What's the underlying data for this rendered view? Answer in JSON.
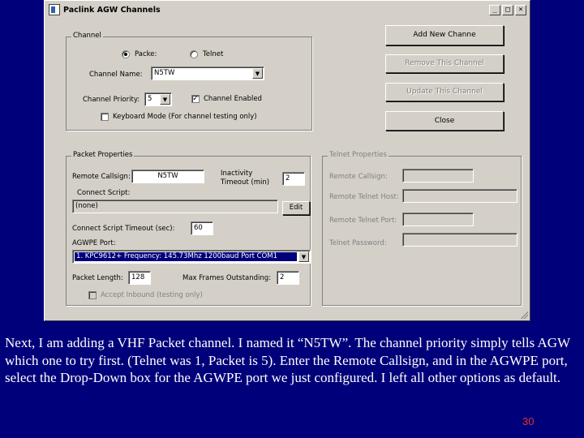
{
  "window": {
    "title": "Paclink AGW Channels",
    "minimize": "_",
    "maximize": "□",
    "close": "×"
  },
  "channel": {
    "legend": "Channel",
    "radio_packet": "Packe:",
    "radio_telnet": "Telnet",
    "name_label": "Channel Name:",
    "name_value": "N5TW",
    "priority_label": "Channel Priority:",
    "priority_value": "5",
    "enabled_label": "Channel Enabled",
    "keyboard_label": "Keyboard Mode (For channel testing only)"
  },
  "buttons": {
    "add": "Add New Channe",
    "remove": "Remove This Channel",
    "update": "Update This Channel",
    "close": "Close"
  },
  "packet": {
    "legend": "Packet Properties",
    "remote_callsign_label": "Remote Callsign:",
    "remote_callsign_value": "N5TW",
    "inactivity_label_1": "Inactivity",
    "inactivity_label_2": "Timeout (min)",
    "inactivity_value": "2",
    "connect_script_label": "Connect Script:",
    "connect_script_value": "(none)",
    "edit_button": "Edit",
    "script_timeout_label": "Connect Script Timeout (sec):",
    "script_timeout_value": "60",
    "agwpe_port_label": "AGWPE Port:",
    "agwpe_port_value": "1. KPC9612+ Frequency: 145.73Mhz 1200baud Port COM1",
    "packet_length_label": "Packet Length:",
    "packet_length_value": "128",
    "max_frames_label": "Max Frames Outstanding:",
    "max_frames_value": "2",
    "accept_inbound_label": "Accept Inbound (testing only)"
  },
  "telnet": {
    "legend": "Telnet Properties",
    "remote_callsign_label": "Remote Callsign:",
    "remote_host_label": "Remote Telnet Host:",
    "remote_port_label": "Remote Telnet Port:",
    "password_label": "Telnet Password:"
  },
  "slide": {
    "caption": "Next, I am adding a VHF Packet channel.  I named it “N5TW”. The channel priority simply tells AGW which one to try first. (Telnet was 1, Packet is 5).  Enter the Remote Callsign, and in the AGWPE port, select the Drop-Down box for the AGWPE port we just configured.  I left all other options as default.",
    "page_number": "30"
  }
}
